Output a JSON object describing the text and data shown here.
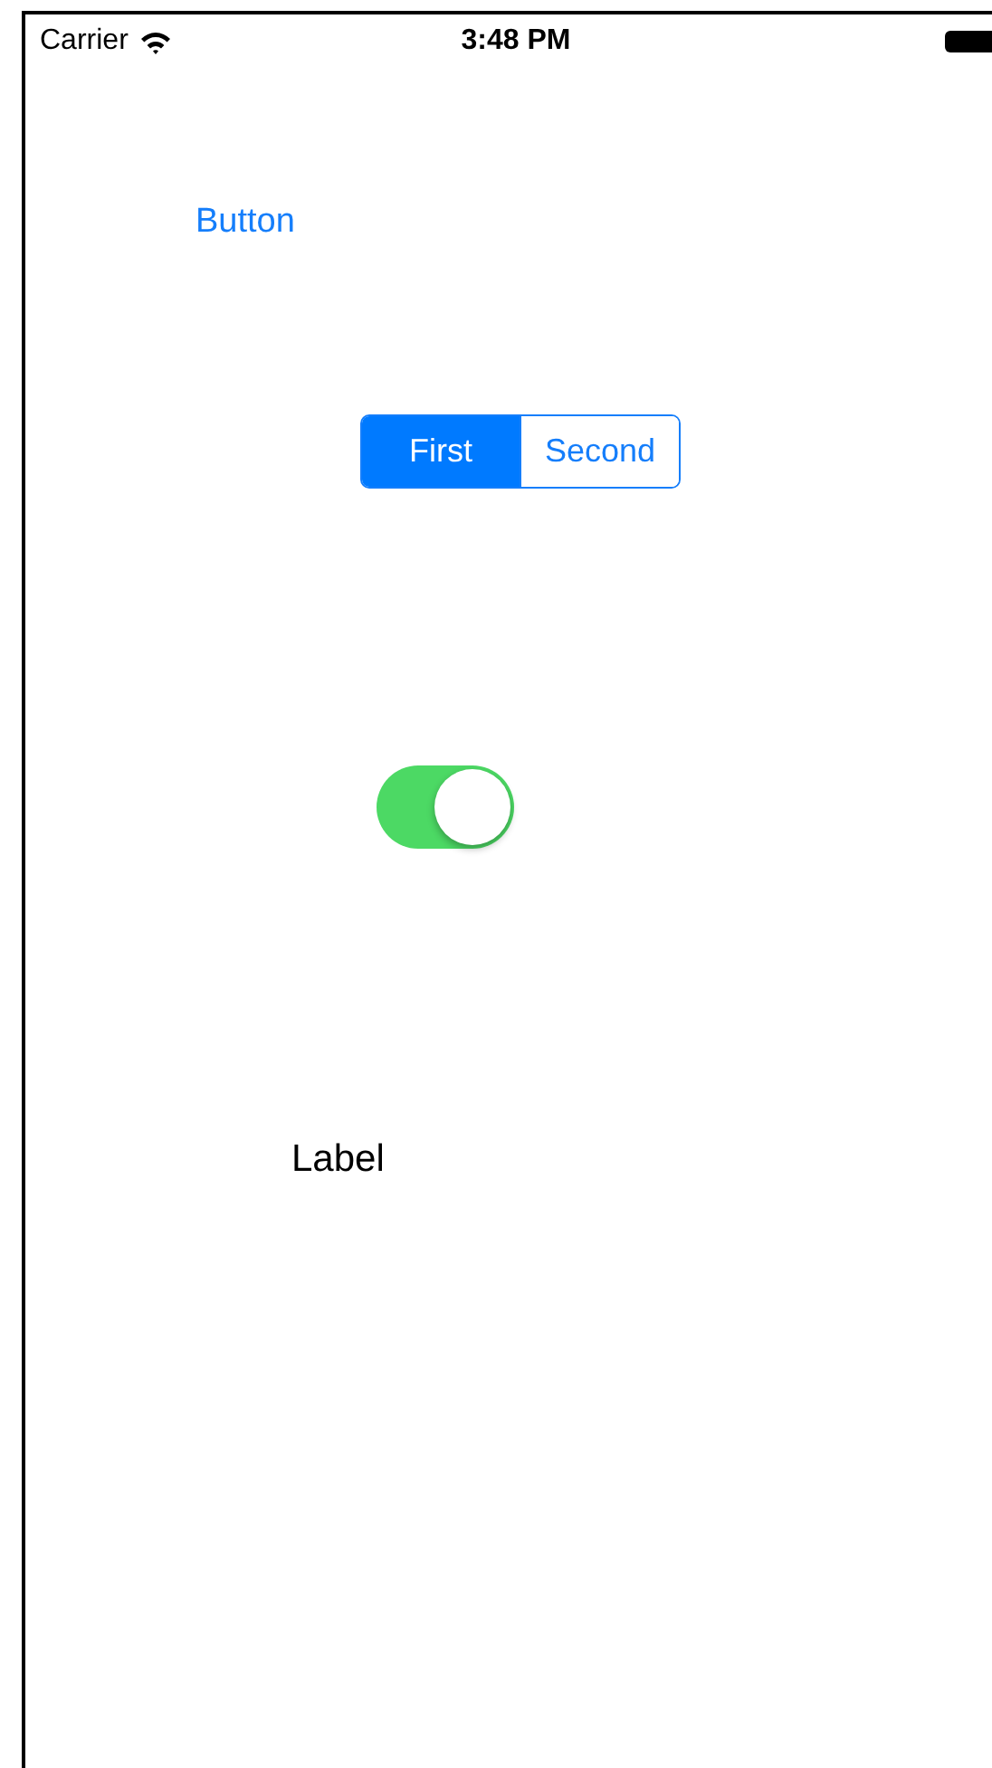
{
  "status_bar": {
    "carrier": "Carrier",
    "time": "3:48 PM"
  },
  "button": {
    "label": "Button"
  },
  "segmented_control": {
    "segments": [
      {
        "label": "First",
        "selected": true
      },
      {
        "label": "Second",
        "selected": false
      }
    ]
  },
  "switch": {
    "on": true
  },
  "label": {
    "text": "Label"
  }
}
